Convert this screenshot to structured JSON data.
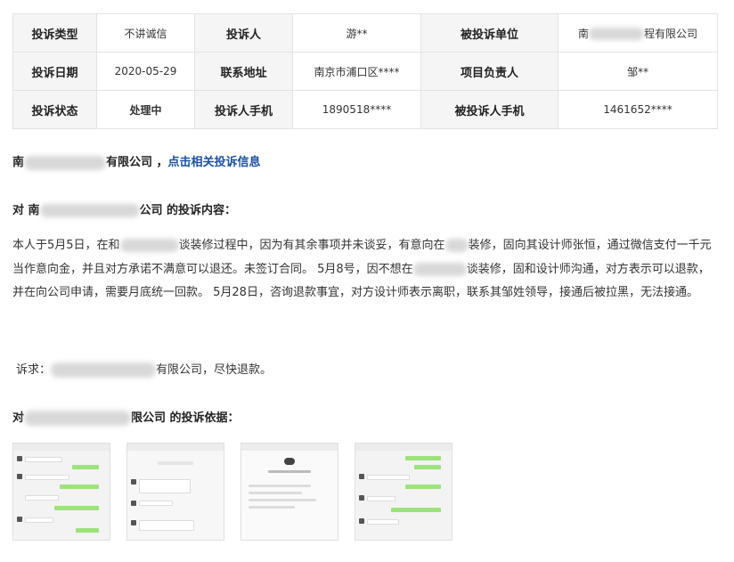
{
  "info_table": {
    "rows": [
      [
        {
          "label": "投诉类型",
          "value": "不讲诚信"
        },
        {
          "label": "投诉人",
          "value": "游**"
        },
        {
          "label": "被投诉单位",
          "value_prefix": "南",
          "value_suffix": "程有限公司"
        }
      ],
      [
        {
          "label": "投诉日期",
          "value": "2020-05-29"
        },
        {
          "label": "联系地址",
          "value": "南京市浦口区****"
        },
        {
          "label": "项目负责人",
          "value": "邹**"
        }
      ],
      [
        {
          "label": "投诉状态",
          "value": "处理中"
        },
        {
          "label": "投诉人手机",
          "value": "1890518****"
        },
        {
          "label": "被投诉人手机",
          "value": "1461652****"
        }
      ]
    ]
  },
  "company_line": {
    "prefix": "南",
    "suffix": "有限公司 ，",
    "link": "点击相关投诉信息"
  },
  "content_heading": {
    "prefix": "对 南",
    "suffix": "公司 的投诉内容："
  },
  "complaint_text": {
    "part1": "本人于5月5日，在和",
    "part2": "谈装修过程中，因为有其余事项并未谈妥，有意向在",
    "part3": "装修，固向其设计师张恒，通过微信支付一千元当作意向金，并且对方承诺不满意可以退还。未签订合同。 5月8号，因不想在",
    "part4": "谈装修，固和设计师沟通，对方表示可以退款，并在向公司申请，需要月底统一回款。 5月28日，咨询退款事宜，对方设计师表示离职，联系其邹姓领导，接通后被拉黑，无法接通。"
  },
  "demand": {
    "prefix": "诉求：",
    "suffix": "有限公司，尽快退款。"
  },
  "evidence_heading": {
    "prefix": "对",
    "suffix": "限公司 的投诉依据："
  },
  "evidence_images": [
    "chat-screenshot",
    "chat-screenshot",
    "chat-screenshot",
    "chat-screenshot"
  ],
  "colors": {
    "accent": "#1a4fa8",
    "label_bg": "#f5f5f5",
    "border": "#e3e3e3"
  }
}
